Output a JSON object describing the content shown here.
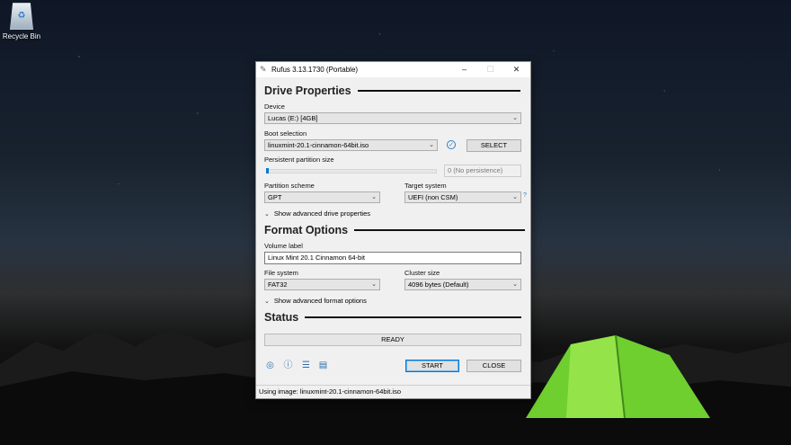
{
  "desktop": {
    "recycle_bin_label": "Recycle Bin"
  },
  "window": {
    "title": "Rufus 3.13.1730 (Portable)",
    "controls": {
      "minimize": "–",
      "maximize": "☐",
      "close": "✕"
    }
  },
  "drive_properties": {
    "heading": "Drive Properties",
    "device_label": "Device",
    "device_value": "Lucas (E:) [4GB]",
    "boot_selection_label": "Boot selection",
    "boot_selection_value": "linuxmint-20.1-cinnamon-64bit.iso",
    "select_button": "SELECT",
    "persistent_label": "Persistent partition size",
    "persistent_value": "0 (No persistence)",
    "persistent_fraction": 0,
    "partition_scheme_label": "Partition scheme",
    "partition_scheme_value": "GPT",
    "target_system_label": "Target system",
    "target_system_value": "UEFI (non CSM)",
    "target_help": "?",
    "advanced_toggle": "Show advanced drive properties"
  },
  "format_options": {
    "heading": "Format Options",
    "volume_label_label": "Volume label",
    "volume_label_value": "Linux Mint 20.1 Cinnamon 64-bit",
    "file_system_label": "File system",
    "file_system_value": "FAT32",
    "cluster_size_label": "Cluster size",
    "cluster_size_value": "4096 bytes (Default)",
    "advanced_toggle": "Show advanced format options"
  },
  "status": {
    "heading": "Status",
    "progress_text": "READY",
    "progress_fraction": 0
  },
  "footer": {
    "start_button": "START",
    "close_button": "CLOSE",
    "status_bar": "Using image: linuxmint-20.1-cinnamon-64bit.iso"
  },
  "icons": {
    "language": "globe-icon",
    "about": "info-icon",
    "settings": "sliders-icon",
    "log": "log-icon",
    "hash_check": "check-icon"
  },
  "colors": {
    "accent": "#0078d7",
    "tent": "#7fd83a"
  }
}
